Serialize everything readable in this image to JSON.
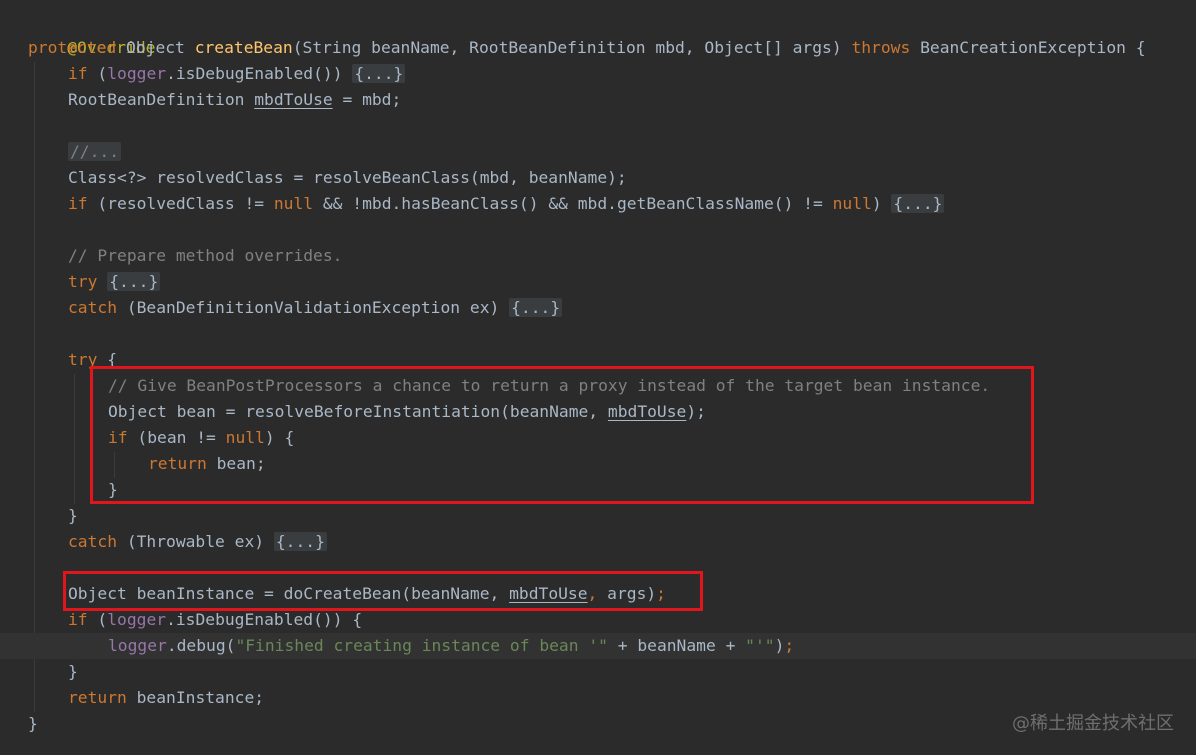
{
  "code": {
    "annotation": "@Override",
    "kw_protected": "protected",
    "type_object": "Object",
    "method_name": "createBean",
    "params": "(String beanName, RootBeanDefinition mbd, Object[] args)",
    "kw_throws": "throws",
    "exception": "BeanCreationException {",
    "kw_if": "if",
    "kw_null": "null",
    "kw_try": "try",
    "kw_catch": "catch",
    "kw_return": "return",
    "logger": "logger",
    "is_debug": ".isDebugEnabled())",
    "fold": "{...}",
    "comment_fold": "//...",
    "open_paren": "(",
    "rbd_decl": "RootBeanDefinition ",
    "mbd_to_use": "mbdToUse",
    "assign_mbd": " = mbd;",
    "class_decl": "Class<?> resolvedClass = resolveBeanClass(mbd, beanName);",
    "resolved_check_a": " (resolvedClass != ",
    "resolved_check_b": " && !mbd.hasBeanClass() && mbd.getBeanClassName() != ",
    "prepare_comment": "// Prepare method overrides.",
    "catch_bdve": " (BeanDefinitionValidationException ex) ",
    "try_open": " {",
    "give_comment": "// Give BeanPostProcessors a chance to return a proxy instead of the target bean instance.",
    "bean_decl": "Object bean = resolveBeforeInstantiation(beanName, ",
    "close_stmt": ");",
    "bean_check_a": " (bean != ",
    "bean_check_b": ") {",
    "return_bean": " bean;",
    "close_brace": "}",
    "catch_throwable": " (Throwable ex) ",
    "instance_decl": "Object beanInstance = doCreateBean(beanName, ",
    "instance_tail": ", args);",
    "if_open": " {",
    "debug_call": ".debug(",
    "debug_string": "\"Finished creating instance of bean '\"",
    "concat": " + beanName + ",
    "quote_string": "\"'\"",
    "return_instance": " beanInstance;",
    "comma_space": ", ",
    "space": " "
  },
  "watermark": "@稀土掘金技术社区"
}
